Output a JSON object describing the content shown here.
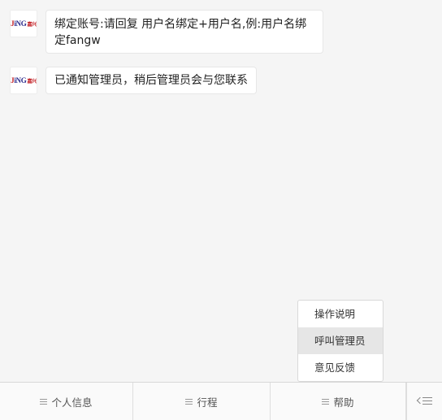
{
  "messages": [
    {
      "avatar_logo": {
        "part1": "J",
        "part2": "iNG",
        "part3": "嘉兴"
      },
      "text": "绑定账号:请回复  用户名绑定+用户名,例:用户名绑定fangw"
    },
    {
      "avatar_logo": {
        "part1": "J",
        "part2": "iNG",
        "part3": "嘉兴"
      },
      "text": "已通知管理员，稍后管理员会与您联系"
    }
  ],
  "popup_menu": {
    "items": [
      {
        "label": "操作说明"
      },
      {
        "label": "呼叫管理员"
      },
      {
        "label": "意见反馈"
      }
    ],
    "highlighted_index": 1
  },
  "menubar": {
    "items": [
      {
        "label": "个人信息",
        "icon": "menu-lines-icon"
      },
      {
        "label": "行程",
        "icon": "menu-lines-icon"
      },
      {
        "label": "帮助",
        "icon": "menu-lines-icon"
      }
    ],
    "toggle_icon": "keyboard-switch-icon"
  },
  "colors": {
    "background": "#f5f5f5",
    "bubble": "#ffffff",
    "highlight": "#e6e6e6",
    "logo_red": "#c0181e",
    "logo_blue": "#2a2a8c"
  }
}
